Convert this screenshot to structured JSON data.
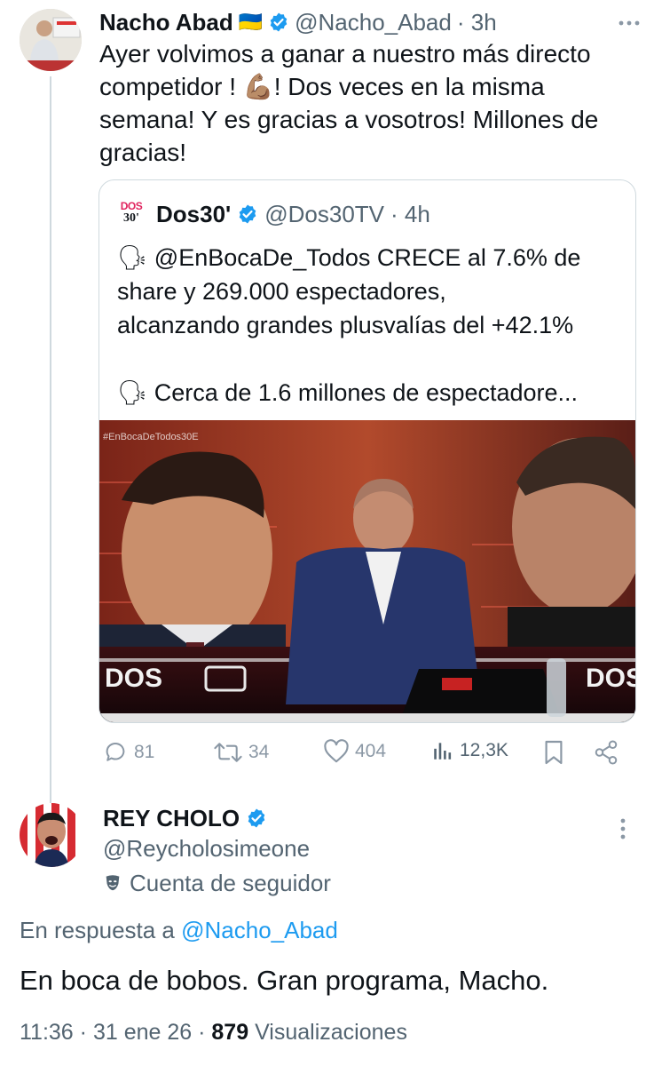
{
  "original_tweet": {
    "author_name": "Nacho Abad",
    "author_flag": "🇺🇦",
    "handle": "@Nacho_Abad",
    "time": "· 3h",
    "text_lines": [
      "Ayer volvimos a ganar a nuestro más directo",
      "competidor ! 💪🏽! Dos veces en la misma",
      "semana! Y es gracias a vosotros! Millones de",
      "gracias!"
    ]
  },
  "quoted_tweet": {
    "logo_text_top": "DOS",
    "logo_text_bottom": "30'",
    "author_name": "Dos30'",
    "handle": "@Dos30TV",
    "time": "· 4h",
    "text_lines": [
      "🗣 @EnBocaDe_Todos CRECE al 7.6% de",
      "share y 269.000 espectadores,",
      "alcanzando grandes plusvalías del +42.1%",
      "",
      "🗣 Cerca de 1.6 millones de espectadore..."
    ],
    "image": {
      "hashtag_overlay": "#EnBocaDeTodos30E",
      "set_text_left": "DOS",
      "set_text_right": "DOS"
    }
  },
  "actions": {
    "replies": "81",
    "retweets": "34",
    "likes": "404",
    "views": "12,3K"
  },
  "reply_tweet": {
    "author_name": "REY CHOLO",
    "handle": "@Reycholosimeone",
    "label": "Cuenta de seguidor",
    "reply_prefix": "En respuesta a",
    "reply_to": "@Nacho_Abad",
    "text": "En boca de bobos. Gran programa, Macho.",
    "time": "11:36",
    "date": "31 ene 26",
    "views_count": "879",
    "views_label": "Visualizaciones"
  },
  "colors": {
    "link": "#1d9bf0",
    "verified": "#1d9bf0",
    "muted": "#536471",
    "action_gray": "#8b98a5"
  }
}
